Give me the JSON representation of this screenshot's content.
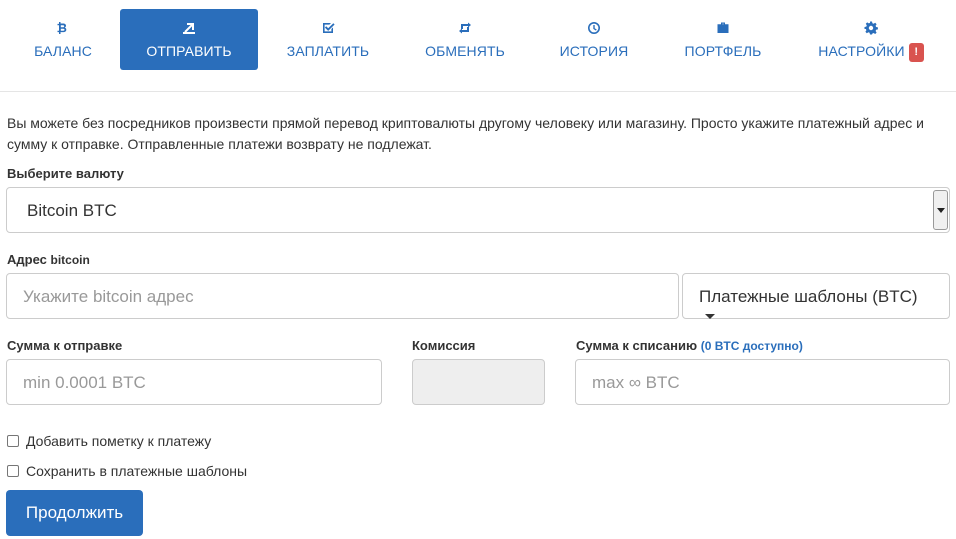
{
  "nav": {
    "items": [
      {
        "label": "БАЛАНС",
        "icon": "bitcoin-icon"
      },
      {
        "label": "ОТПРАВИТЬ",
        "icon": "send-icon",
        "active": true
      },
      {
        "label": "ЗАПЛАТИТЬ",
        "icon": "check-square-icon"
      },
      {
        "label": "ОБМЕНЯТЬ",
        "icon": "retweet-icon"
      },
      {
        "label": "ИСТОРИЯ",
        "icon": "clock-icon"
      },
      {
        "label": "ПОРТФЕЛЬ",
        "icon": "briefcase-icon"
      },
      {
        "label": "НАСТРОЙКИ",
        "icon": "gear-icon",
        "badge": "!"
      }
    ]
  },
  "intro_text": "Вы можете без посредников произвести прямой перевод криптовалюты другому человеку или магазину. Просто укажите платежный адрес и сумму к отправке. Отправленные платежи возврату не подлежат.",
  "currency": {
    "label": "Выберите валюту",
    "selected": "Bitcoin BTC"
  },
  "address": {
    "label": "Адрес",
    "label_small": "bitcoin",
    "placeholder": "Укажите bitcoin адрес",
    "templates_button": "Платежные шаблоны (BTC)"
  },
  "amount": {
    "label": "Сумма к отправке",
    "placeholder": "min 0.0001 BTC"
  },
  "fee": {
    "label": "Комиссия",
    "value": ""
  },
  "debit": {
    "label": "Сумма к списанию",
    "available": "(0 BTC доступно)",
    "placeholder": "max ∞ BTC"
  },
  "checkboxes": {
    "add_note": "Добавить пометку к платежу",
    "save_template": "Сохранить в платежные шаблоны"
  },
  "submit_label": "Продолжить",
  "colors": {
    "accent": "#2a6ebb",
    "badge": "#d9534f"
  }
}
